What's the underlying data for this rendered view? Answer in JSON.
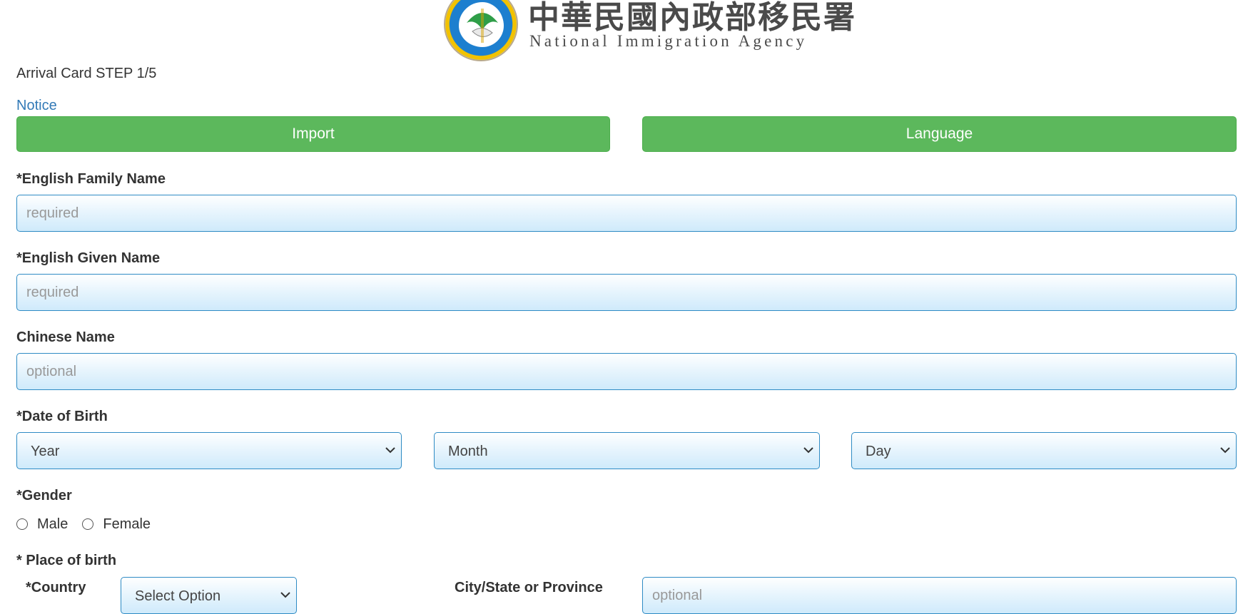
{
  "header": {
    "agency_chinese": "中華民國內政部移民署",
    "agency_english": "National Immigration Agency",
    "seal_text": "National Immigration Agency",
    "logo_icon": "national-immigration-agency-seal"
  },
  "form": {
    "step_title": "Arrival Card STEP 1/5",
    "notice_link": "Notice",
    "import_button": "Import",
    "language_button": "Language",
    "family_name": {
      "label": "*English Family Name",
      "placeholder": "required",
      "value": ""
    },
    "given_name": {
      "label": "*English Given Name",
      "placeholder": "required",
      "value": ""
    },
    "chinese_name": {
      "label": "Chinese Name",
      "placeholder": "optional",
      "value": ""
    },
    "date_of_birth": {
      "label": "*Date of Birth",
      "year": "Year",
      "month": "Month",
      "day": "Day"
    },
    "gender": {
      "label": "*Gender",
      "options": [
        "Male",
        "Female"
      ],
      "selected": ""
    },
    "place_of_birth": {
      "label": "* Place of birth",
      "country_label": "*Country",
      "country_value": "Select Option",
      "city_label": "City/State or Province",
      "city_placeholder": "optional",
      "city_value": ""
    }
  },
  "colors": {
    "button_green": "#5cb85c",
    "input_border": "#2e8bc4",
    "link_blue": "#337ab7",
    "input_gradient_bottom": "#cfeafb"
  }
}
